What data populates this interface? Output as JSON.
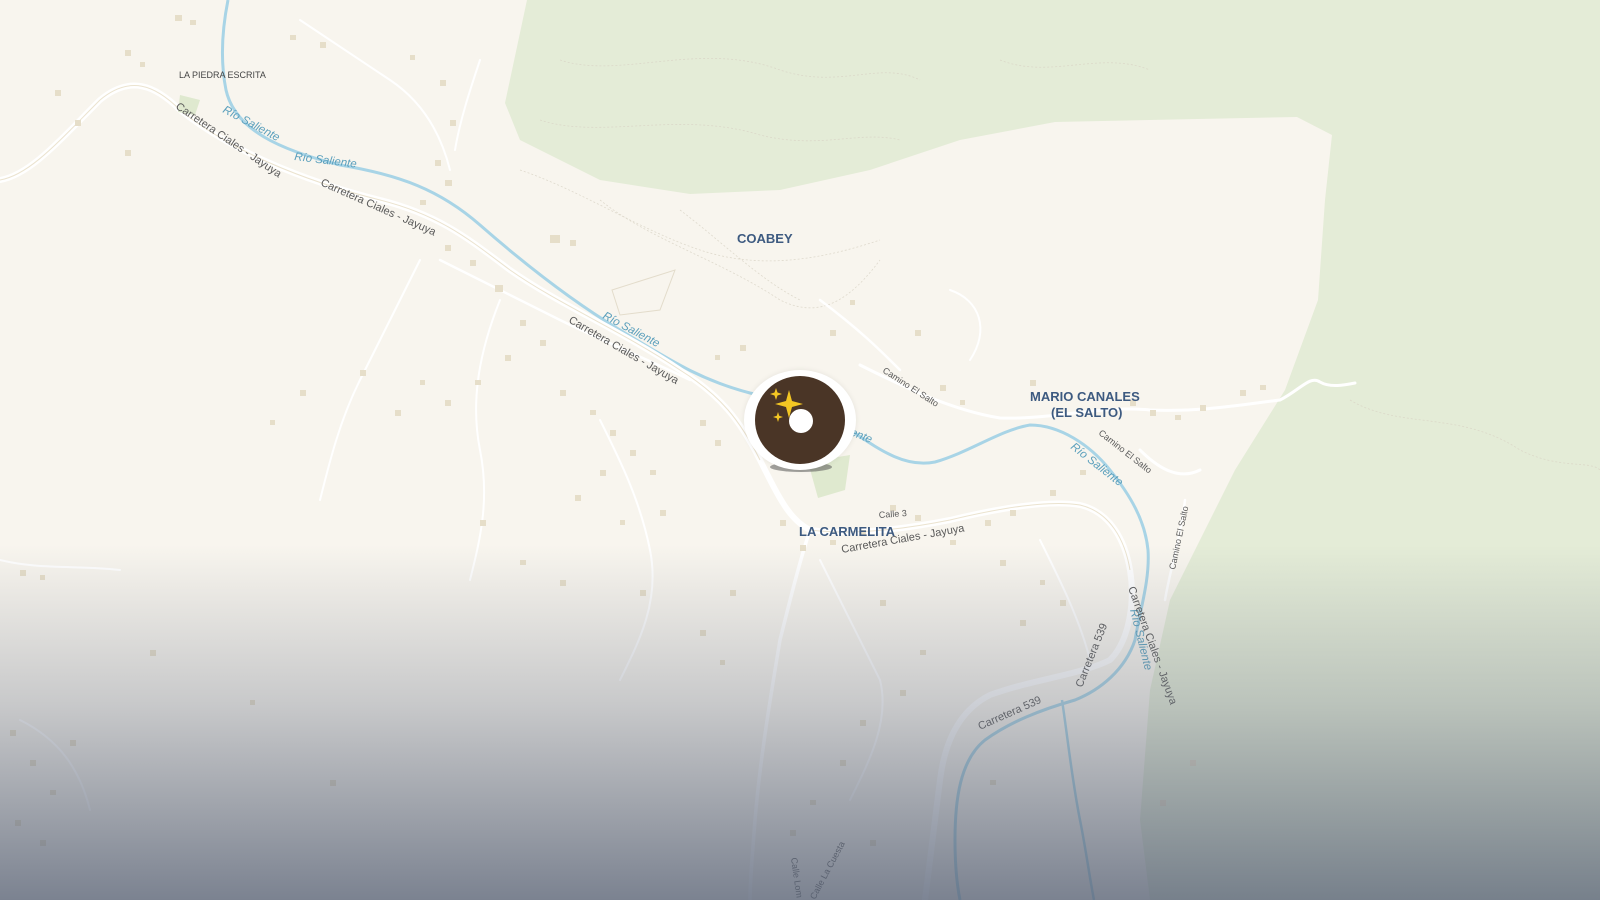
{
  "places": {
    "la_piedra_escrita": "LA PIEDRA ESCRITA",
    "coabey": "COABEY",
    "mario_canales_line1": "MARIO CANALES",
    "mario_canales_line2": "(EL SALTO)",
    "la_carmelita": "LA CARMELITA"
  },
  "roads": {
    "cj_1": "Carretera Ciales - Jayuya",
    "cj_2": "Carretera Ciales - Jayuya",
    "cj_3": "Carretera Ciales - Jayuya",
    "cj_4": "Carretera Ciales - Jayuya",
    "cj_5": "Carretera Ciales - Jayuya",
    "camino_salto_1": "Camino El Salto",
    "camino_salto_2": "Camino El Salto",
    "camino_salto_3": "Camino El Salto",
    "calle_3": "Calle 3",
    "carretera_539_a": "Carretera 539",
    "carretera_539_b": "Carretera 539",
    "calle_la_cuesta": "Calle La Cuesta",
    "calle_lom": "Calle Lom"
  },
  "rivers": {
    "r1": "Río Saliente",
    "r2": "Río Saliente",
    "r3": "Río Saliente",
    "r4": "liente",
    "r5": "Río Saliente",
    "r6": "Río Saliente"
  },
  "colors": {
    "land": "#f8f5ee",
    "forest": "#e3ecd5",
    "river": "#a8d4e6",
    "road": "#ffffff",
    "place_label": "#3d5a80",
    "marker_brown": "#4a3526",
    "sparkle": "#f3c623"
  },
  "marker": {
    "icon": "donut-sparkle-icon"
  }
}
